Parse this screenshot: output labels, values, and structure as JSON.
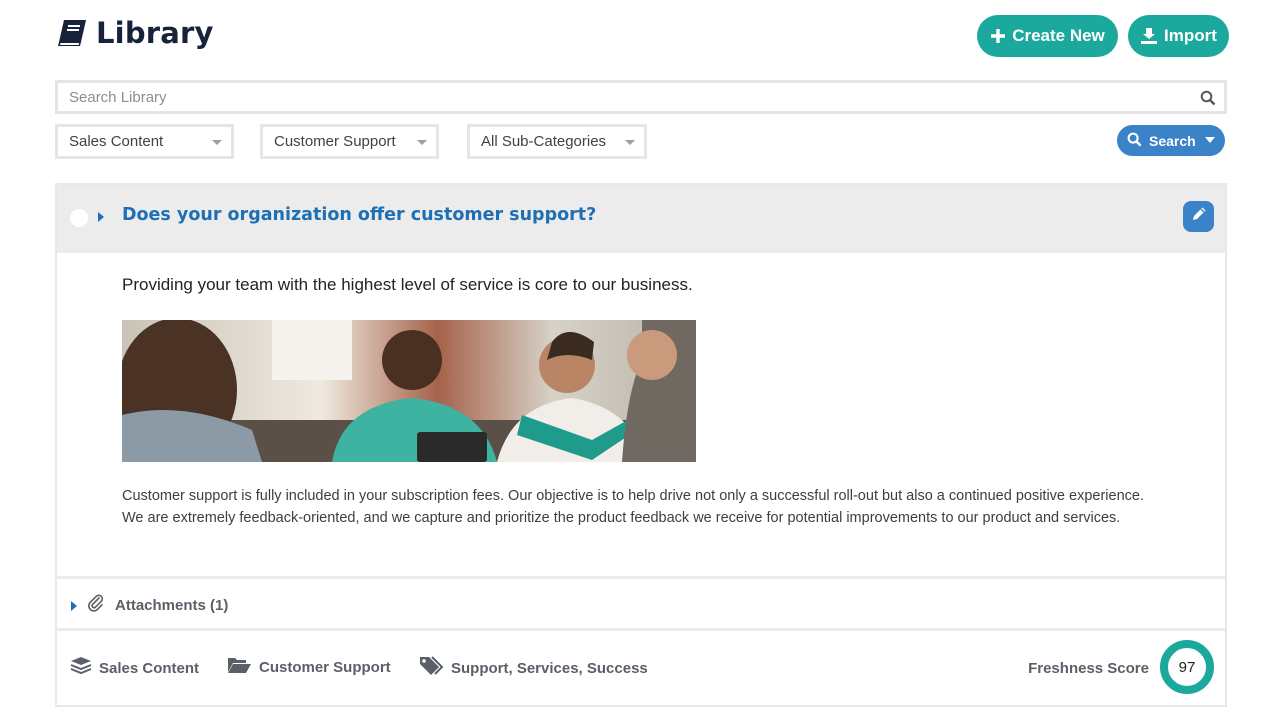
{
  "header": {
    "title": "Library",
    "title_icon": "book-icon",
    "create_button": {
      "label": "Create New",
      "icon": "plus-icon"
    },
    "import_button": {
      "label": "Import",
      "icon": "import-icon"
    }
  },
  "search": {
    "placeholder": "Search Library",
    "value": "",
    "icon": "search-icon"
  },
  "filters": {
    "category": "Sales Content",
    "subject": "Customer Support",
    "subcategory": "All Sub-Categories"
  },
  "search_button": {
    "label": "Search"
  },
  "colors": {
    "accent_teal": "#1aa99c",
    "accent_blue": "#3b83c9",
    "question_blue": "#1f6fb5",
    "title_navy": "#17223b"
  },
  "entry": {
    "question": "Does your organization offer customer support?",
    "lead": "Providing your team with the highest level of service is core to our business.",
    "body": "Customer support is fully included in your subscription fees. Our objective is to help drive not only a successful roll-out but also a continued positive experience. We are extremely feedback-oriented, and we capture and prioritize the product feedback we receive for potential improvements to our product and services.",
    "attachments_label": "Attachments (1)",
    "meta": {
      "category": "Sales Content",
      "folder": "Customer Support",
      "tags": "Support, Services, Success"
    },
    "freshness_label": "Freshness Score",
    "freshness_score": "97"
  }
}
